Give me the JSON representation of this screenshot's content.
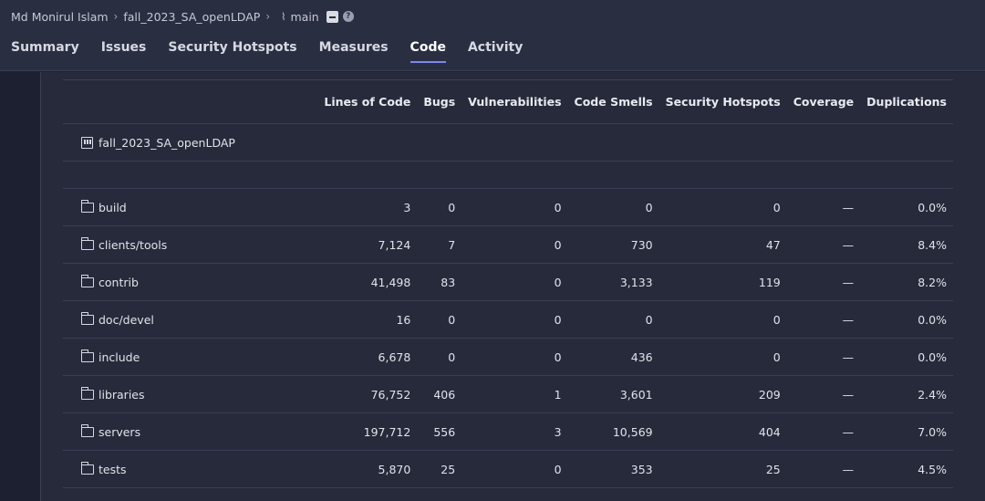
{
  "breadcrumb": {
    "owner": "Md Monirul Islam",
    "project": "fall_2023_SA_openLDAP",
    "branch": "main"
  },
  "tabs": [
    {
      "label": "Summary",
      "active": false
    },
    {
      "label": "Issues",
      "active": false
    },
    {
      "label": "Security Hotspots",
      "active": false
    },
    {
      "label": "Measures",
      "active": false
    },
    {
      "label": "Code",
      "active": true
    },
    {
      "label": "Activity",
      "active": false
    }
  ],
  "table": {
    "columns": [
      "Lines of Code",
      "Bugs",
      "Vulnerabilities",
      "Code Smells",
      "Security Hotspots",
      "Coverage",
      "Duplications"
    ],
    "project_row": {
      "name": "fall_2023_SA_openLDAP"
    },
    "rows": [
      {
        "name": "build",
        "cells": [
          "3",
          "0",
          "0",
          "0",
          "0",
          "—",
          "0.0%"
        ]
      },
      {
        "name": "clients/tools",
        "cells": [
          "7,124",
          "7",
          "0",
          "730",
          "47",
          "—",
          "8.4%"
        ]
      },
      {
        "name": "contrib",
        "cells": [
          "41,498",
          "83",
          "0",
          "3,133",
          "119",
          "—",
          "8.2%"
        ]
      },
      {
        "name": "doc/devel",
        "cells": [
          "16",
          "0",
          "0",
          "0",
          "0",
          "—",
          "0.0%"
        ]
      },
      {
        "name": "include",
        "cells": [
          "6,678",
          "0",
          "0",
          "436",
          "0",
          "—",
          "0.0%"
        ]
      },
      {
        "name": "libraries",
        "cells": [
          "76,752",
          "406",
          "1",
          "3,601",
          "209",
          "—",
          "2.4%"
        ]
      },
      {
        "name": "servers",
        "cells": [
          "197,712",
          "556",
          "3",
          "10,569",
          "404",
          "—",
          "7.0%"
        ]
      },
      {
        "name": "tests",
        "cells": [
          "5,870",
          "25",
          "0",
          "353",
          "25",
          "—",
          "4.5%"
        ]
      }
    ]
  }
}
